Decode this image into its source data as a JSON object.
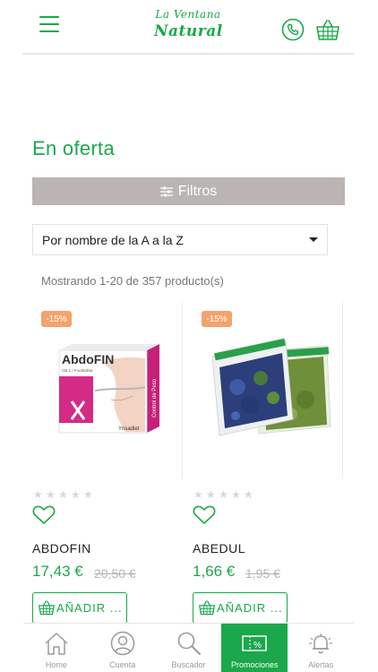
{
  "header": {
    "logo_line1": "La Ventana",
    "logo_line2": "Natural"
  },
  "page": {
    "title": "En oferta",
    "filters_label": "Filtros",
    "sort_selected": "Por nombre de la A a la Z",
    "showing_text": "Mostrando 1-20 de 357 producto(s)"
  },
  "products": [
    {
      "badge": "-15%",
      "name": "ABDOFIN",
      "price": "17,43 €",
      "old_price": "20,50 €",
      "add_label": "AÑADIR ...",
      "box_brand": "AbdoFIN",
      "box_subtitle": "CB.1 / Forskolina",
      "box_side": "Control de Peso",
      "box_maker": "Ynsadiet",
      "rating_stars": 0
    },
    {
      "badge": "-15%",
      "name": "ABEDUL",
      "price": "1,66 €",
      "old_price": "1,95 €",
      "add_label": "AÑADIR ...",
      "rating_stars": 0
    }
  ],
  "bottom_nav": {
    "items": [
      {
        "label": "Home",
        "icon": "home-icon"
      },
      {
        "label": "Cuenta",
        "icon": "user-icon"
      },
      {
        "label": "Buscador",
        "icon": "search-icon"
      },
      {
        "label": "Promociones",
        "icon": "promo-icon",
        "active": true
      },
      {
        "label": "Alertas",
        "icon": "bell-icon"
      }
    ]
  },
  "colors": {
    "brand_green": "#1aa84a",
    "filters_bg": "#bcb4b2",
    "badge_orange": "#f4a26e"
  }
}
